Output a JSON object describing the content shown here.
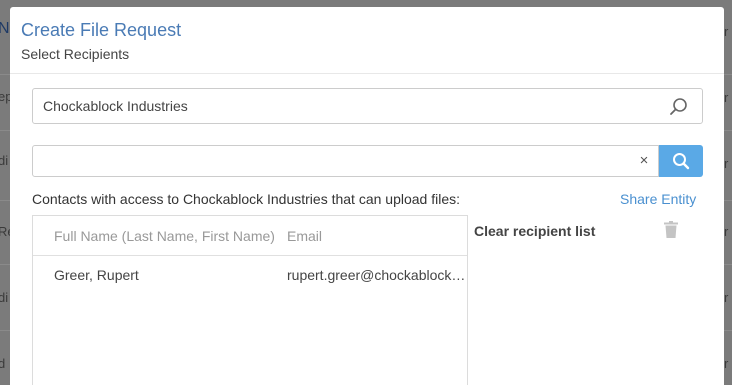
{
  "background": {
    "left_fragments": [
      "N",
      "ep",
      "di",
      "Re",
      "di",
      "d"
    ],
    "right_fragments": [
      "r",
      "r",
      "r",
      "r",
      "r",
      "r"
    ]
  },
  "modal": {
    "title": "Create File Request",
    "subtitle": "Select Recipients"
  },
  "entity_search": {
    "value": "Chockablock Industries",
    "icon": "search-icon"
  },
  "recipient_search": {
    "value": "",
    "clear_label": "×",
    "button_icon": "search-icon"
  },
  "contacts": {
    "caption": "Contacts with access to Chockablock Industries that can upload files:",
    "share_entity_label": "Share Entity",
    "columns": {
      "name": "Full Name (Last Name, First Name)",
      "email": "Email"
    },
    "rows": [
      {
        "name": "Greer, Rupert",
        "email": "rupert.greer@chockablock.com"
      }
    ]
  },
  "recipients": {
    "clear_label": "Clear recipient list",
    "trash_icon": "trash-icon"
  },
  "colors": {
    "title": "#4a7bb5",
    "link": "#4a90d0",
    "search_button": "#5aa9e6",
    "overlay": "#7b7b7b"
  }
}
